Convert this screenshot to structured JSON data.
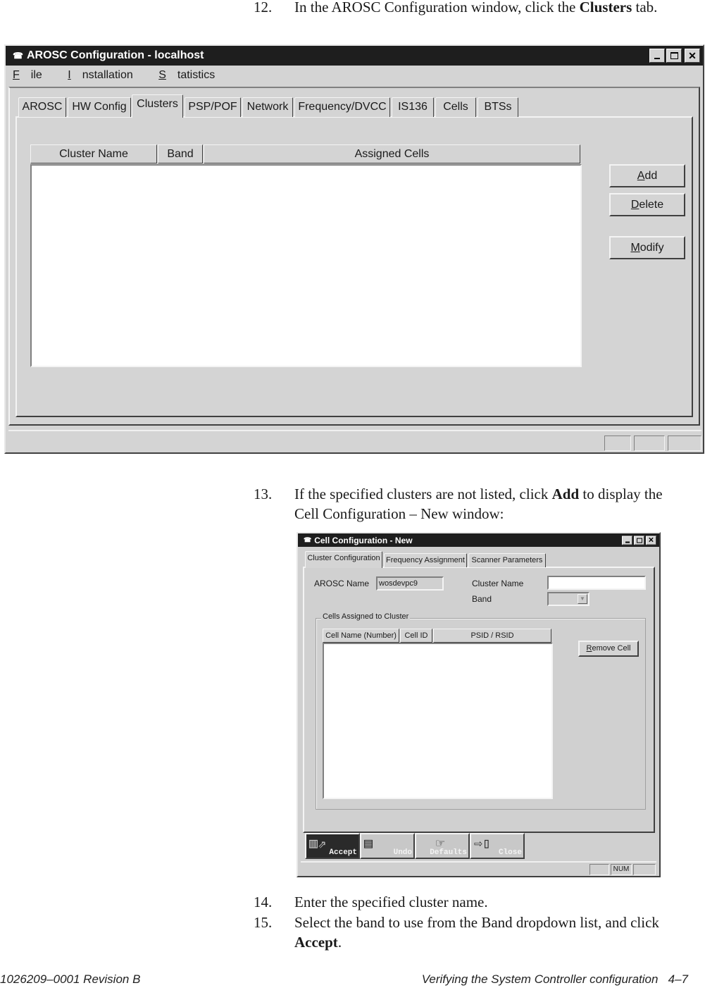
{
  "steps": [
    {
      "num": "12.",
      "text_pre": "In the AROSC Configuration window, click the ",
      "bold": "Clusters",
      "text_post": " tab."
    },
    {
      "num": "13.",
      "text_pre": "If the specified clusters are not listed, click ",
      "bold": "Add",
      "text_post": " to display the Cell Configuration – New window:"
    },
    {
      "num": "14.",
      "text_pre": "Enter the specified cluster name.",
      "bold": "",
      "text_post": ""
    },
    {
      "num": "15.",
      "text_pre": "Select the band to use from the Band dropdown list, and click ",
      "bold": "Accept",
      "text_post": "."
    }
  ],
  "arosc_window": {
    "title": "AROSC Configuration - localhost",
    "menu": [
      {
        "first": "F",
        "rest": "ile"
      },
      {
        "first": "I",
        "rest": "nstallation"
      },
      {
        "first": "S",
        "rest": "tatistics"
      }
    ],
    "tabs": [
      "AROSC",
      "HW Config",
      "Clusters",
      "PSP/POF",
      "Network",
      "Frequency/DVCC",
      "IS136",
      "Cells",
      "BTSs"
    ],
    "active_tab": "Clusters",
    "columns": [
      "Cluster Name",
      "Band",
      "Assigned Cells"
    ],
    "rows": [],
    "buttons": [
      {
        "first": "A",
        "rest": "dd"
      },
      {
        "first": "D",
        "rest": "elete"
      },
      {
        "first": "M",
        "rest": "odify"
      }
    ]
  },
  "cell_window": {
    "title": "Cell Configuration - New",
    "tabs": [
      "Cluster Configuration",
      "Frequency Assignment",
      "Scanner Parameters"
    ],
    "active_tab": "Cluster Configuration",
    "arosc_name_label": "AROSC Name",
    "arosc_name_value": "wosdevpc9",
    "cluster_name_label": "Cluster Name",
    "cluster_name_value": "",
    "band_label": "Band",
    "band_value": "",
    "group_label": "Cells Assigned to Cluster",
    "columns": [
      "Cell Name (Number)",
      "Cell ID",
      "PSID / RSID"
    ],
    "rows": [],
    "remove_button": {
      "first": "R",
      "rest": "emove Cell"
    },
    "toolbar": [
      "Accept",
      "Undo",
      "Defaults",
      "Close"
    ],
    "status_num": "NUM"
  },
  "footer": {
    "left": "1026209–0001  Revision B",
    "right": "Verifying the System Controller configuration   4–7"
  }
}
